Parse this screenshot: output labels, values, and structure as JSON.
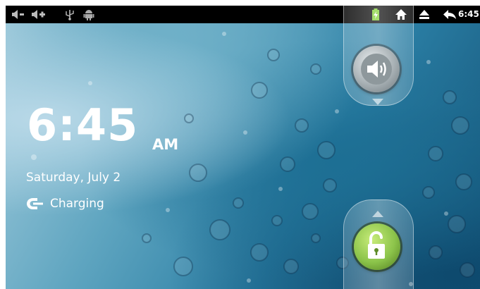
{
  "status_bar": {
    "left_icons": [
      "volume-down-icon",
      "volume-up-icon",
      "usb-icon",
      "android-debug-icon"
    ],
    "right_icons": [
      "battery-charging-icon",
      "home-icon",
      "eject-icon",
      "back-icon"
    ],
    "clock": "6:45"
  },
  "lock_screen": {
    "time": "6:45",
    "am_pm": "AM",
    "date": "Saturday, July 2",
    "charging_icon": "charging-plug-icon",
    "charging_text": "Charging"
  },
  "tabs": {
    "sound_toggle_icon": "speaker-icon",
    "unlock_icon": "unlock-icon"
  },
  "colors": {
    "status_bar_bg": "#000000",
    "unlock_orb": "#8bc34a",
    "sound_orb": "#9ea7ab",
    "battery": "#7cd12a"
  }
}
